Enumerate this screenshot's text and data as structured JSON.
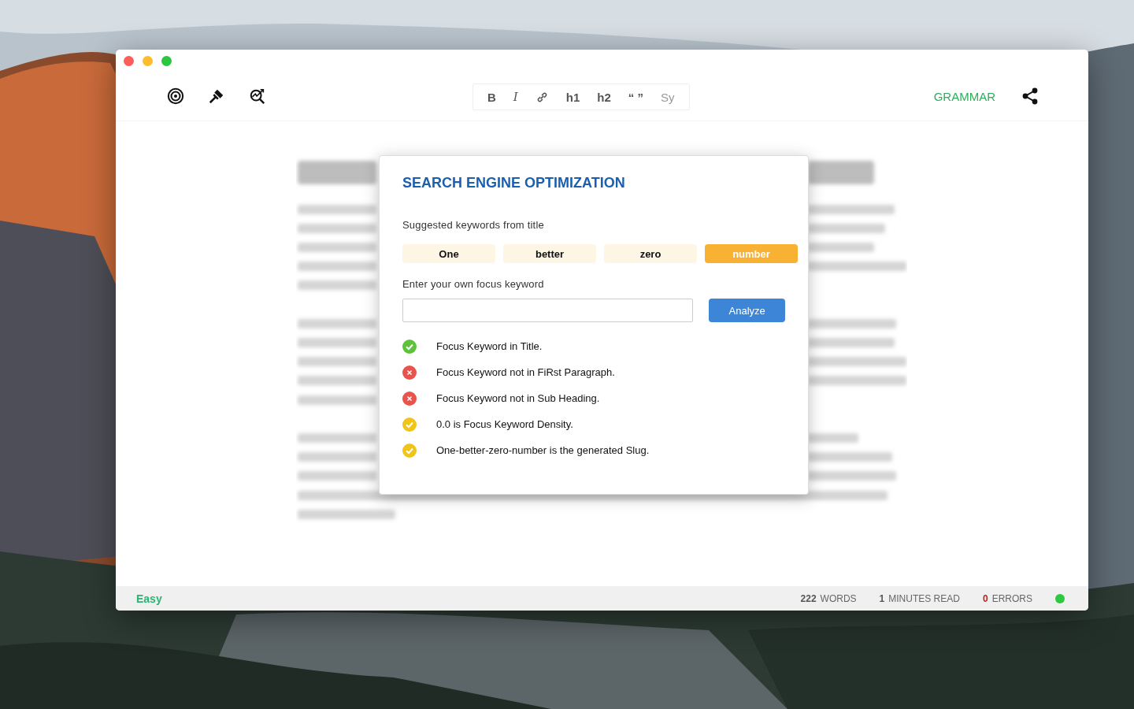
{
  "toolbar": {
    "tools": [
      {
        "kind": "target"
      },
      {
        "kind": "brush"
      },
      {
        "kind": "analytics"
      }
    ],
    "format": [
      {
        "label": "B",
        "kind": "bold",
        "disabled": false
      },
      {
        "label": "I",
        "kind": "italic",
        "disabled": false
      },
      {
        "kind": "link",
        "disabled": false
      },
      {
        "label": "h1",
        "kind": "text",
        "disabled": false
      },
      {
        "label": "h2",
        "kind": "text",
        "disabled": false
      },
      {
        "label": "“ ”",
        "kind": "text",
        "disabled": false
      },
      {
        "label": "Sy",
        "kind": "text",
        "disabled": true
      }
    ],
    "grammar": "GRAMMAR"
  },
  "seo": {
    "title": "SEARCH ENGINE OPTIMIZATION",
    "keywords_label": "Suggested keywords from title",
    "keywords": [
      {
        "label": "One",
        "selected": false
      },
      {
        "label": "better",
        "selected": false
      },
      {
        "label": "zero",
        "selected": false
      },
      {
        "label": "number",
        "selected": true
      }
    ],
    "focus_label": "Enter your own focus keyword",
    "analyze": "Analyze",
    "checks": [
      {
        "kind": "pass",
        "text": "Focus Keyword in Title."
      },
      {
        "kind": "fail",
        "text": "Focus Keyword not in FiRst Paragraph."
      },
      {
        "kind": "fail",
        "text": "Focus Keyword not in Sub Heading."
      },
      {
        "kind": "warn",
        "text": "0.0 is Focus Keyword Density."
      },
      {
        "kind": "warn",
        "text": "One-better-zero-number is the generated Slug."
      }
    ]
  },
  "status_bar": {
    "readability": "Easy",
    "stats": [
      {
        "value": "222",
        "label": "WORDS",
        "kind": "normal"
      },
      {
        "value": "1",
        "label": "MINUTES READ",
        "kind": "normal"
      },
      {
        "value": "0",
        "label": "ERRORS",
        "kind": "error"
      }
    ],
    "connected": true
  }
}
